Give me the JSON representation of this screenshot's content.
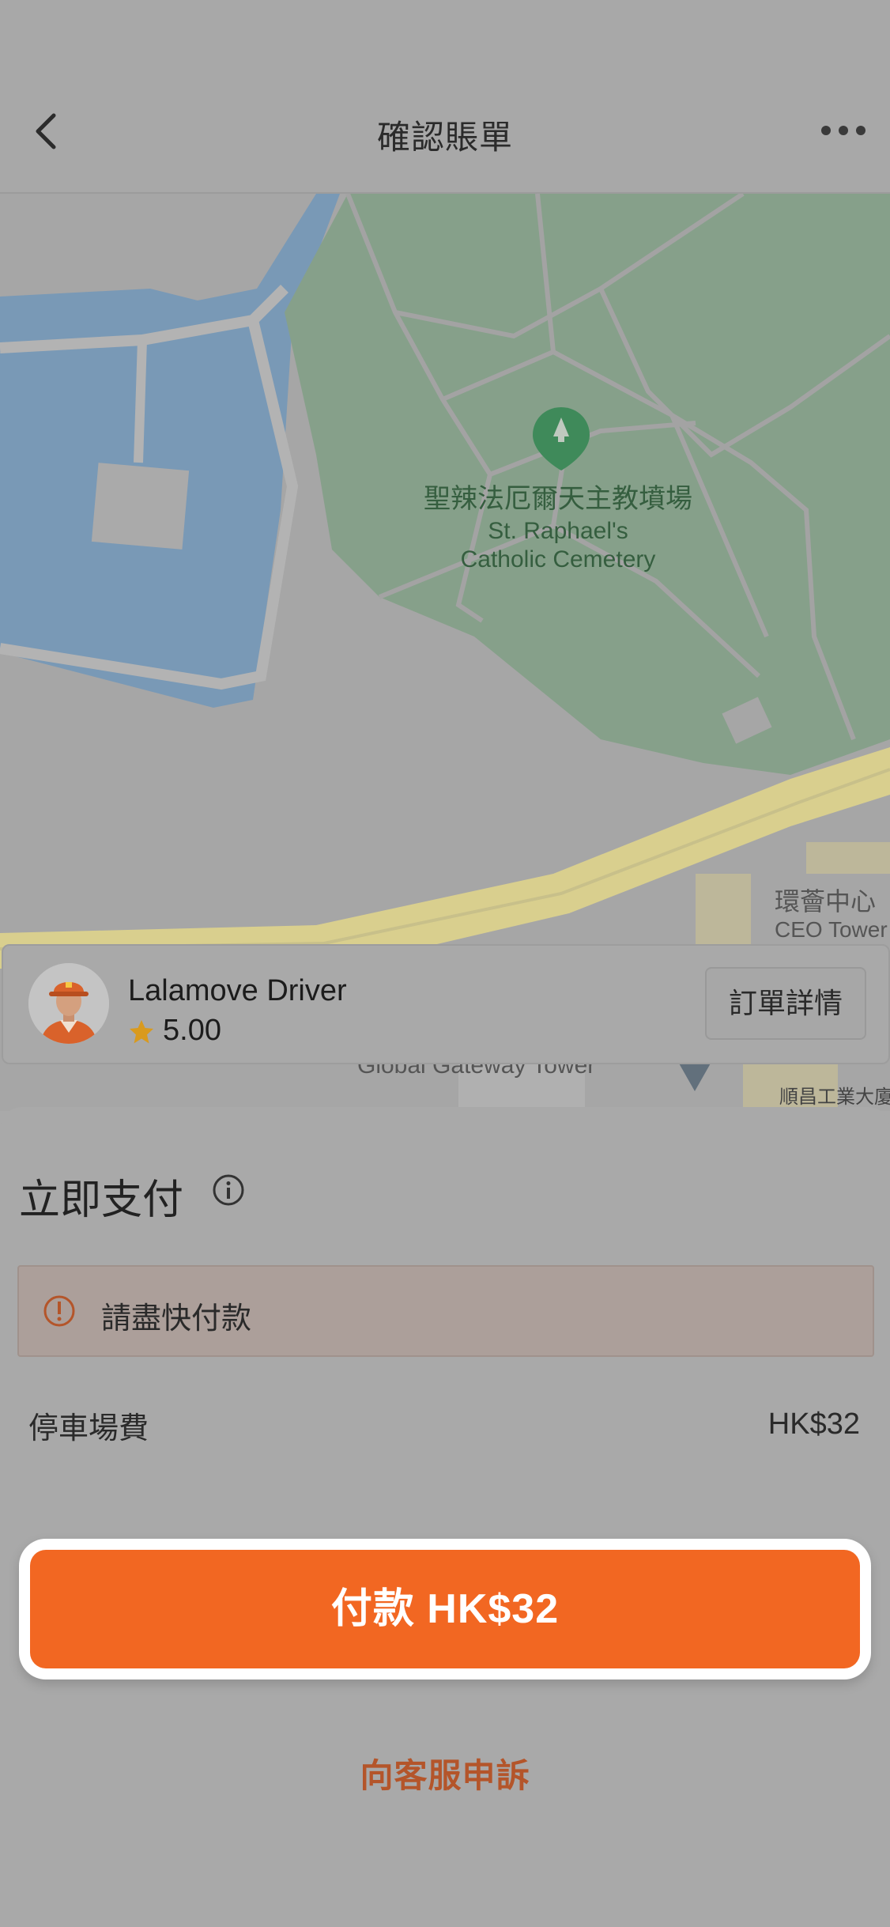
{
  "header": {
    "title": "確認賬單"
  },
  "map": {
    "labels": {
      "cemetery_zh": "聖辣法厄爾天主教墳場",
      "cemetery_en_1": "St. Raphael's",
      "cemetery_en_2": "Catholic Cemetery",
      "building_1": "環薈中心",
      "building_2": "CEO Tower",
      "building_3": "Global Gateway Tower",
      "building_4": "順昌工業大廈"
    }
  },
  "driver": {
    "name": "Lalamove Driver",
    "rating": "5.00",
    "details_button": "訂單詳情"
  },
  "payment": {
    "title": "立即支付",
    "warning": "請盡快付款",
    "fee_label": "停車場費",
    "fee_value": "HK$32",
    "pay_button": "付款 HK$32",
    "complaint_link": "向客服申訴"
  },
  "colors": {
    "accent": "#f26722",
    "complaint_text": "#b4552a",
    "map_park": "#86a08a",
    "map_water": "#7999b6",
    "map_road": "#d9cf8e"
  },
  "icons": {
    "back": "back-icon",
    "more": "more-icon",
    "info": "info-icon",
    "warning": "warning-icon",
    "star": "star-icon",
    "cemetery_pin": "map-pin-icon"
  }
}
